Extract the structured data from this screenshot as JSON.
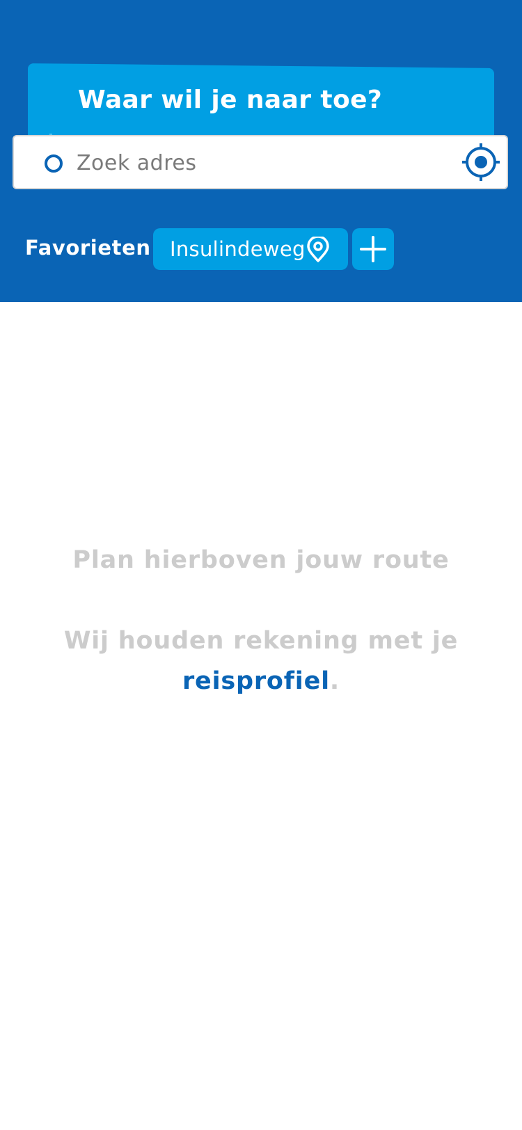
{
  "header": {
    "title": "Waar wil je naar toe?",
    "background_color": "#0a64b5",
    "accent_color": "#019fe3"
  },
  "search": {
    "placeholder": "Zoek adres",
    "value": "",
    "origin_icon": "origin-circle-icon",
    "locate_icon": "current-location-icon"
  },
  "favorites": {
    "label": "Favorieten",
    "items": [
      {
        "label": "Insulindeweg",
        "icon": "location-pin-icon"
      }
    ],
    "add_icon": "plus-icon"
  },
  "empty_state": {
    "line1": "Plan hierboven jouw route",
    "line2_prefix": "Wij houden rekening met je ",
    "line2_link": "reisprofiel",
    "line2_suffix": ".",
    "text_color": "#cccccc",
    "link_color": "#0a64b5"
  }
}
